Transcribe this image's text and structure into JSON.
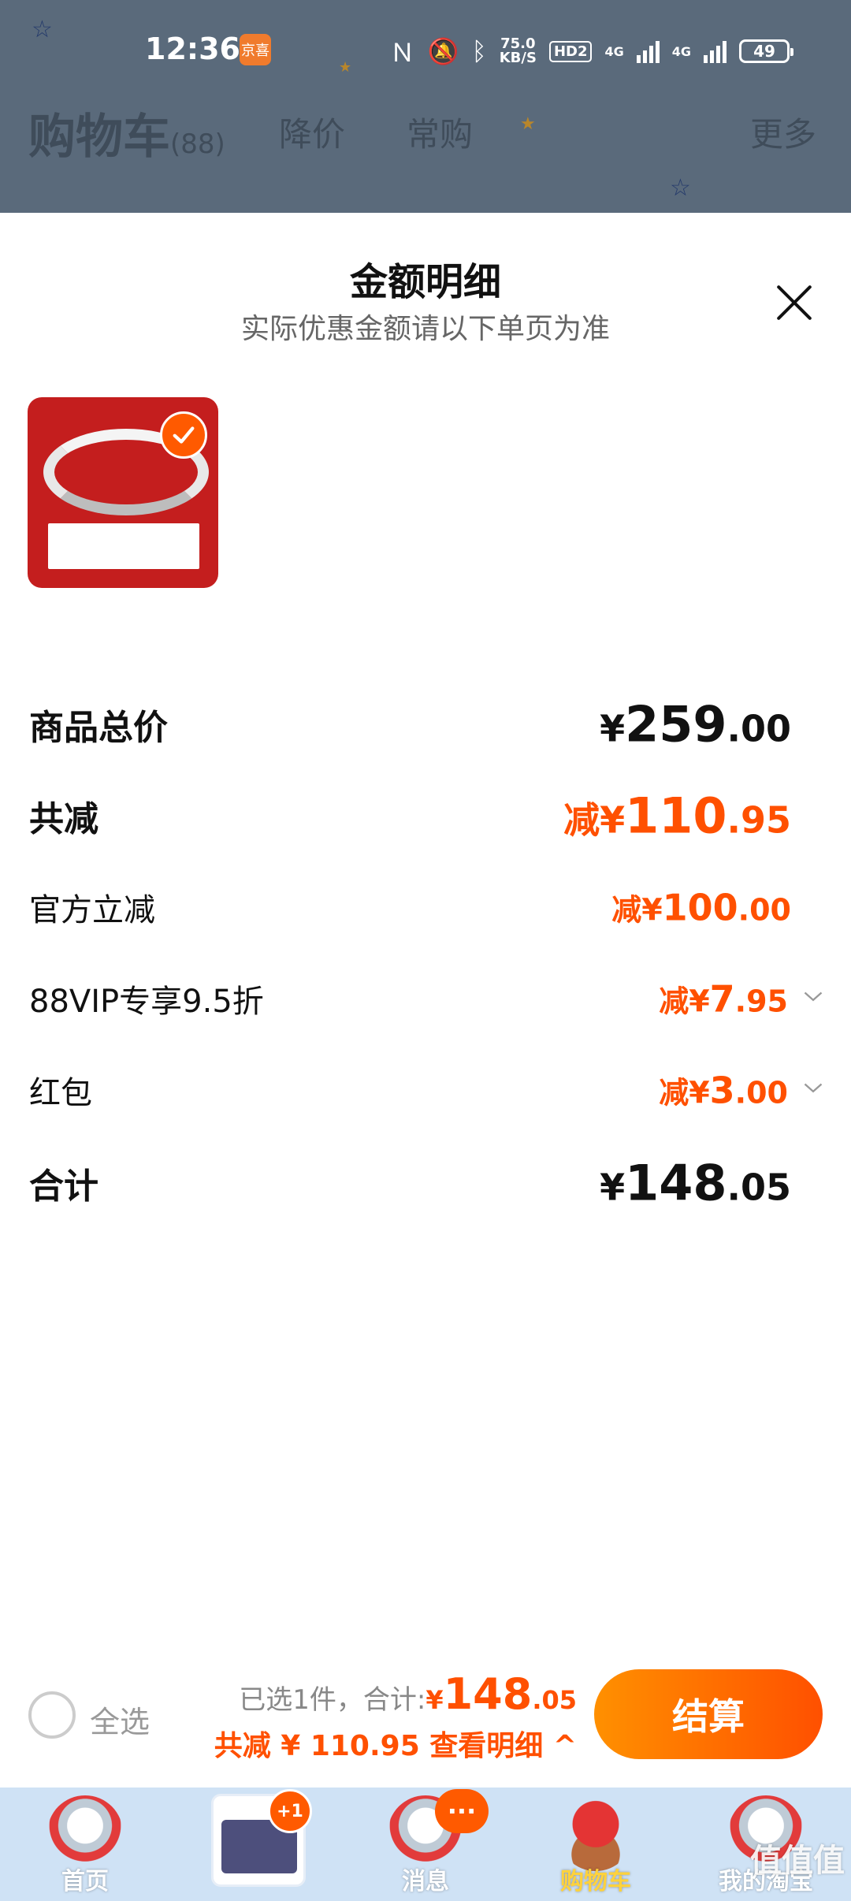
{
  "status_bar": {
    "time": "12:36",
    "app_badge": "京喜",
    "net_speed_value": "75.0",
    "net_speed_unit": "KB/S",
    "hd_label": "HD2",
    "signal_label_1": "4G",
    "signal_label_2": "4G",
    "battery": "49"
  },
  "cart_header": {
    "title": "购物车",
    "count": "(88)",
    "tab_price_drop": "降价",
    "tab_frequent": "常购",
    "tab_more": "更多"
  },
  "sheet": {
    "title": "金额明细",
    "subtitle": "实际优惠金额请以下单页为准"
  },
  "product": {
    "selected": true,
    "thumb_icon": "silver-bracelet-image"
  },
  "breakdown": {
    "total_price": {
      "label": "商品总价",
      "currency": "¥",
      "int": "259",
      "dec": ".00"
    },
    "total_discount": {
      "label": "共减",
      "prefix": "减¥",
      "int": "110",
      "dec": ".95"
    },
    "official_discount": {
      "label": "官方立减",
      "prefix": "减¥",
      "int": "100",
      "dec": ".00"
    },
    "vip_discount": {
      "label": "88VIP专享9.5折",
      "prefix": "减¥",
      "int": "7",
      "dec": ".95"
    },
    "red_packet": {
      "label": "红包",
      "prefix": "减¥",
      "int": "3",
      "dec": ".00"
    },
    "grand_total": {
      "label": "合计",
      "currency": "¥",
      "int": "148",
      "dec": ".05"
    }
  },
  "checkout_bar": {
    "select_all": "全选",
    "selected_text": "已选1件，合计:",
    "total_currency": "¥",
    "total_int": "148",
    "total_dec": ".05",
    "discount_detail": "共减 ¥ 110.95  查看明细 ^",
    "checkout_button": "结算"
  },
  "tab_bar": {
    "home": "首页",
    "promo_badge": "+1",
    "messages": "消息",
    "messages_badge": "···",
    "cart": "购物车",
    "mine": "我的淘宝"
  },
  "watermark": "值值值",
  "colors": {
    "accent_orange": "#ff5000",
    "dim_overlay": "#5a6a7b",
    "tab_bar_bg": "#cfe2f5"
  }
}
